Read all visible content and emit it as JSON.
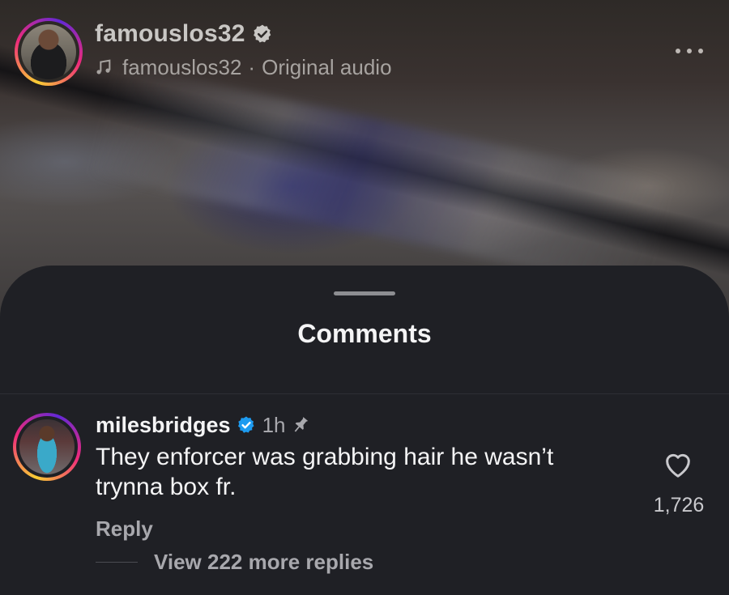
{
  "post": {
    "username": "famouslos32",
    "audio_owner": "famouslos32",
    "audio_separator": "·",
    "audio_label": "Original audio",
    "verified_icon": "verified-badge-icon",
    "music_icon": "music-note-icon",
    "more_icon": "more-options-icon"
  },
  "sheet": {
    "title": "Comments"
  },
  "comment": {
    "username": "milesbridges",
    "verified_icon": "verified-badge-icon",
    "time": "1h",
    "pinned_icon": "pin-icon",
    "text": "They enforcer was grabbing hair he wasn’t trynna box fr.",
    "reply_label": "Reply",
    "like_icon": "heart-icon",
    "like_count": "1,726",
    "view_replies_label": "View 222 more replies"
  },
  "colors": {
    "sheet_background": "#1f2025",
    "primary_text": "#f4f4f5",
    "secondary_text": "#a8a8ad",
    "verified_blue": "#1d9bf0"
  }
}
